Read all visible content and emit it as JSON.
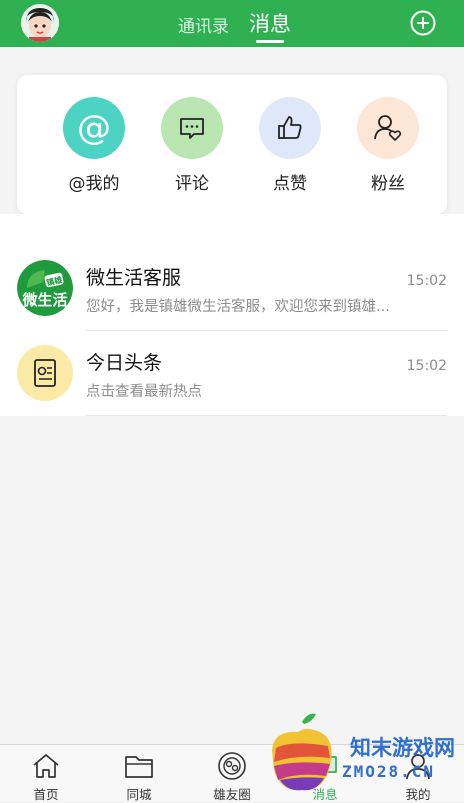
{
  "header": {
    "tab_contacts": "通讯录",
    "tab_messages": "消息",
    "accent_color": "#2fb152"
  },
  "quick_actions": [
    {
      "label": "@我的",
      "icon": "at-icon",
      "color": "#4dd3c4"
    },
    {
      "label": "评论",
      "icon": "comment-icon",
      "color": "#b9e6b0"
    },
    {
      "label": "点赞",
      "icon": "thumbs-up-icon",
      "color": "#dfe7fb"
    },
    {
      "label": "粉丝",
      "icon": "fans-icon",
      "color": "#fde6d6"
    }
  ],
  "chats": [
    {
      "name": "微生活客服",
      "preview": "您好，我是镇雄微生活客服，欢迎您来到镇雄...",
      "time": "15:02",
      "avatar_text": "微生活",
      "avatar_badge": "镇雄"
    },
    {
      "name": "今日头条",
      "preview": "点击查看最新热点",
      "time": "15:02"
    }
  ],
  "bottom_nav": [
    {
      "label": "首页",
      "icon": "home-icon"
    },
    {
      "label": "同城",
      "icon": "folder-icon"
    },
    {
      "label": "雄友圈",
      "icon": "circle-icon"
    },
    {
      "label": "消息",
      "icon": "message-icon",
      "active": true
    },
    {
      "label": "我的",
      "icon": "profile-icon"
    }
  ],
  "watermark": {
    "line1": "知末游戏网",
    "line2": "ZMO28.CN"
  }
}
